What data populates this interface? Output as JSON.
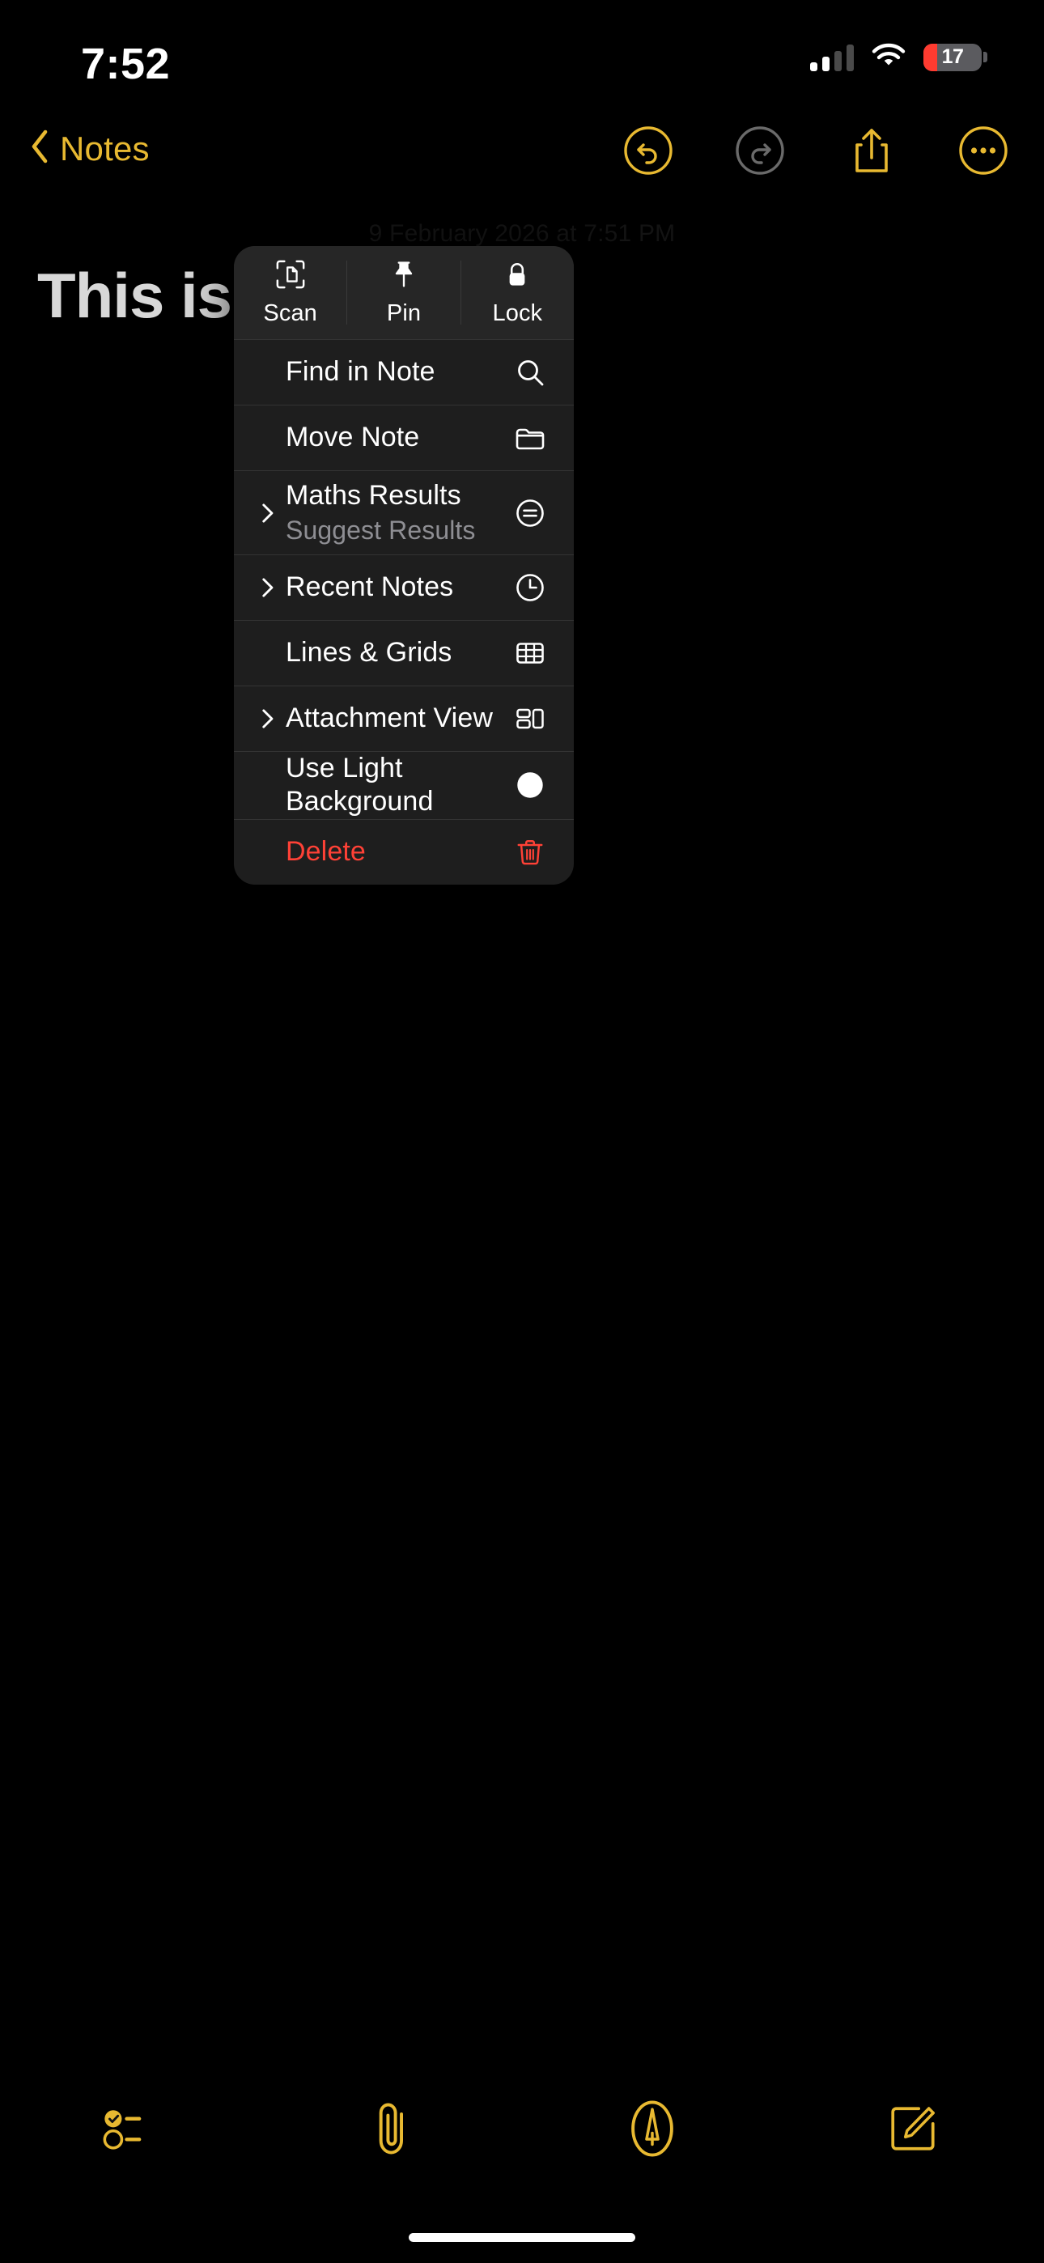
{
  "status_bar": {
    "time": "7:52",
    "battery_level": "17",
    "cellular_icon": "cellular-bars-icon",
    "wifi_icon": "wifi-icon",
    "battery_icon": "battery-low-icon",
    "battery_color": "#ff3b30"
  },
  "nav": {
    "back_label": "Notes",
    "back_icon": "chevron-left-icon",
    "accent_color": "#e8b931",
    "actions": [
      {
        "name": "undo-button",
        "icon": "undo-circle-icon",
        "enabled": true
      },
      {
        "name": "redo-button",
        "icon": "redo-circle-icon",
        "enabled": false
      },
      {
        "name": "share-button",
        "icon": "share-icon",
        "enabled": true
      },
      {
        "name": "more-options-button",
        "icon": "ellipsis-circle-icon",
        "enabled": true
      }
    ]
  },
  "note": {
    "date": "9 February 2026 at 7:51 PM",
    "title": "This is a test"
  },
  "menu": {
    "header": [
      {
        "label": "Scan",
        "icon": "document-scan-icon"
      },
      {
        "label": "Pin",
        "icon": "pin-icon"
      },
      {
        "label": "Lock",
        "icon": "lock-icon"
      }
    ],
    "rows": [
      {
        "title": "Find in Note",
        "subtitle": "",
        "icon": "search-icon",
        "chevron": false,
        "destructive": false
      },
      {
        "title": "Move Note",
        "subtitle": "",
        "icon": "folder-icon",
        "chevron": false,
        "destructive": false
      },
      {
        "title": "Maths Results",
        "subtitle": "Suggest Results",
        "icon": "equals-circle-icon",
        "chevron": true,
        "destructive": false
      },
      {
        "title": "Recent Notes",
        "subtitle": "",
        "icon": "clock-icon",
        "chevron": true,
        "destructive": false
      },
      {
        "title": "Lines & Grids",
        "subtitle": "",
        "icon": "grid-table-icon",
        "chevron": false,
        "destructive": false
      },
      {
        "title": "Attachment View",
        "subtitle": "",
        "icon": "attachment-layout-icon",
        "chevron": true,
        "destructive": false
      },
      {
        "title": "Use Light Background",
        "subtitle": "",
        "icon": "contrast-circle-icon",
        "chevron": false,
        "destructive": false
      },
      {
        "title": "Delete",
        "subtitle": "",
        "icon": "trash-icon",
        "chevron": false,
        "destructive": true
      }
    ],
    "destructive_color": "#ff4136",
    "background_color": "#1e1e1e",
    "header_background_color": "#262626"
  },
  "toolbar": {
    "buttons": [
      {
        "name": "checklist-button",
        "icon": "checklist-icon"
      },
      {
        "name": "attachment-button",
        "icon": "paperclip-icon"
      },
      {
        "name": "markup-button",
        "icon": "markup-pen-circle-icon"
      },
      {
        "name": "compose-button",
        "icon": "compose-icon"
      }
    ],
    "accent_color": "#e8b931"
  }
}
